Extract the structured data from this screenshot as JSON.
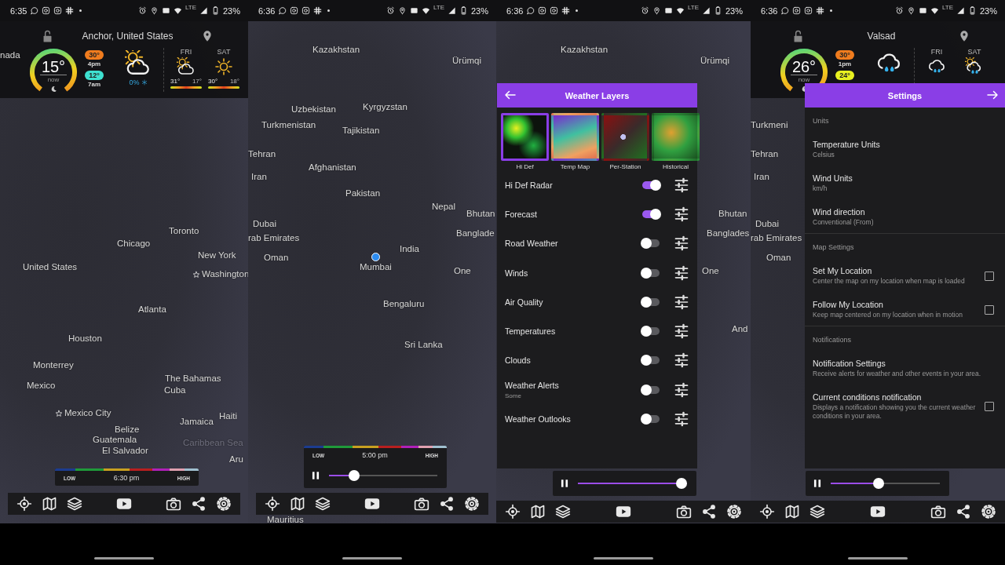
{
  "screens": [
    {
      "kind": "map",
      "status_bar": {
        "time": "6:35",
        "network": "LTE",
        "battery": "23%"
      },
      "weather": {
        "location": "Anchor, United States",
        "current": {
          "temp": "15°",
          "label": "now"
        },
        "high": {
          "temp": "30°",
          "time": "4pm",
          "color": "#f07c1e"
        },
        "low": {
          "temp": "12°",
          "time": "7am",
          "color": "#3ee0d0"
        },
        "condition": {
          "kind": "partly-cloudy",
          "precip": "0%"
        },
        "days": [
          {
            "day": "FRI",
            "kind": "partly-cloudy",
            "high": "31°",
            "low": "17°"
          },
          {
            "day": "SAT",
            "kind": "sunny",
            "high": "30°",
            "low": "18°"
          }
        ]
      },
      "map_labels": [
        {
          "text": "nada",
          "kind": "place"
        },
        {
          "text": "United States",
          "kind": "place"
        },
        {
          "text": "Chicago",
          "kind": "place"
        },
        {
          "text": "Toronto",
          "kind": "place"
        },
        {
          "text": "New York",
          "kind": "place"
        },
        {
          "text": "Washington",
          "kind": "capital"
        },
        {
          "text": "Atlanta",
          "kind": "place"
        },
        {
          "text": "Houston",
          "kind": "place"
        },
        {
          "text": "Monterrey",
          "kind": "place"
        },
        {
          "text": "Mexico",
          "kind": "place"
        },
        {
          "text": "The Bahamas",
          "kind": "place"
        },
        {
          "text": "Cuba",
          "kind": "place"
        },
        {
          "text": "Mexico City",
          "kind": "capital"
        },
        {
          "text": "Haiti",
          "kind": "place"
        },
        {
          "text": "Belize",
          "kind": "place"
        },
        {
          "text": "Jamaica",
          "kind": "place"
        },
        {
          "text": "Guatemala",
          "kind": "place"
        },
        {
          "text": "El Salvador",
          "kind": "place"
        },
        {
          "text": "Caribbean Sea",
          "kind": "sea"
        },
        {
          "text": "Aru",
          "kind": "place"
        }
      ],
      "player": {
        "legend": {
          "low": "LOW",
          "time": "6:30 pm",
          "high": "HIGH"
        }
      }
    },
    {
      "kind": "map",
      "status_bar": {
        "time": "6:36",
        "network": "LTE",
        "battery": "23%"
      },
      "map_labels": [
        {
          "text": "Kazakhstan",
          "kind": "place"
        },
        {
          "text": "Ürümqi",
          "kind": "place"
        },
        {
          "text": "Uzbekistan",
          "kind": "place"
        },
        {
          "text": "Kyrgyzstan",
          "kind": "place"
        },
        {
          "text": "Turkmenistan",
          "kind": "place"
        },
        {
          "text": "Tajikistan",
          "kind": "place"
        },
        {
          "text": "Tehran",
          "kind": "place"
        },
        {
          "text": "Afghanistan",
          "kind": "place"
        },
        {
          "text": "Iran",
          "kind": "place"
        },
        {
          "text": "Pakistan",
          "kind": "place"
        },
        {
          "text": "Nepal",
          "kind": "place"
        },
        {
          "text": "Bhutan",
          "kind": "place"
        },
        {
          "text": "Banglade",
          "kind": "place"
        },
        {
          "text": "Dubai",
          "kind": "place"
        },
        {
          "text": "rab Emirates",
          "kind": "place"
        },
        {
          "text": "Oman",
          "kind": "place"
        },
        {
          "text": "India",
          "kind": "place"
        },
        {
          "text": "Mumbai",
          "kind": "located"
        },
        {
          "text": "One",
          "kind": "place"
        },
        {
          "text": "Bengaluru",
          "kind": "place"
        },
        {
          "text": "Sri Lanka",
          "kind": "place"
        },
        {
          "text": "Mauritius",
          "kind": "place"
        }
      ],
      "player": {
        "legend": {
          "low": "LOW",
          "time": "5:00 pm",
          "high": "HIGH"
        },
        "playing": true,
        "level": 0.2
      }
    },
    {
      "kind": "layers",
      "status_bar": {
        "time": "6:36",
        "network": "LTE",
        "battery": "23%"
      },
      "map_labels": [
        {
          "text": "Kazakhstan",
          "kind": "place"
        },
        {
          "text": "Ürümqi",
          "kind": "place"
        },
        {
          "text": "Bhutan",
          "kind": "place"
        },
        {
          "text": "Banglades",
          "kind": "place"
        },
        {
          "text": "One",
          "kind": "place"
        },
        {
          "text": "And",
          "kind": "place"
        }
      ],
      "layers_card": {
        "title": "Weather Layers",
        "thumbnails": [
          {
            "label": "Hi Def",
            "selected": true
          },
          {
            "label": "Temp Map",
            "selected": false
          },
          {
            "label": "Per-Station",
            "selected": false
          },
          {
            "label": "Historical",
            "selected": false
          }
        ],
        "layers": [
          {
            "label": "Hi Def Radar",
            "on": true
          },
          {
            "label": "Forecast",
            "on": true
          },
          {
            "label": "Road Weather",
            "on": false
          },
          {
            "label": "Winds",
            "on": false
          },
          {
            "label": "Air Quality",
            "on": false
          },
          {
            "label": "Temperatures",
            "on": false
          },
          {
            "label": "Clouds",
            "on": false
          },
          {
            "label": "Weather Alerts",
            "detail": "Some",
            "on": false
          },
          {
            "label": "Weather Outlooks",
            "on": false
          }
        ]
      },
      "player": {
        "playing": true,
        "level": 1
      }
    },
    {
      "kind": "settings",
      "status_bar": {
        "time": "6:36",
        "network": "LTE",
        "battery": "23%"
      },
      "weather": {
        "location": "Valsad",
        "current": {
          "temp": "26°",
          "label": "now"
        },
        "high": {
          "temp": "30°",
          "time": "1pm",
          "color": "#f07c1e"
        },
        "low": {
          "temp": "24°",
          "color": "#e8f020"
        },
        "condition": {
          "kind": "rain"
        },
        "days": [
          {
            "day": "FRI",
            "kind": "rain"
          },
          {
            "day": "SAT",
            "kind": "sun-rain"
          }
        ]
      },
      "map_labels": [
        {
          "text": "Turkmeni",
          "kind": "place"
        },
        {
          "text": "Tehran",
          "kind": "place"
        },
        {
          "text": "Iran",
          "kind": "place"
        },
        {
          "text": "Dubai",
          "kind": "place"
        },
        {
          "text": "rab Emirates",
          "kind": "place"
        },
        {
          "text": "Oman",
          "kind": "place"
        }
      ],
      "settings_card": {
        "title": "Settings",
        "sections": [
          {
            "heading": "Units",
            "items": [
              {
                "kind": "value",
                "title": "Temperature Units",
                "detail": "Celsius"
              },
              {
                "kind": "value",
                "title": "Wind Units",
                "detail": "km/h"
              },
              {
                "kind": "value",
                "title": "Wind direction",
                "detail": "Conventional (From)"
              }
            ]
          },
          {
            "heading": "Map Settings",
            "items": [
              {
                "kind": "checkbox",
                "title": "Set My Location",
                "detail": "Center the map on my location when map is loaded",
                "checked": false
              },
              {
                "kind": "checkbox",
                "title": "Follow My Location",
                "detail": "Keep map centered on my location when in motion",
                "checked": false
              }
            ]
          },
          {
            "heading": "Notifications",
            "items": [
              {
                "kind": "value",
                "title": "Notification Settings",
                "detail": "Receive alerts for weather and other events in your area."
              },
              {
                "kind": "checkbox",
                "title": "Current conditions notification",
                "detail": "Displays a notification showing you the current weather conditions in your area.",
                "checked": false
              }
            ]
          }
        ]
      },
      "player": {
        "playing": true,
        "level": 0.43
      }
    }
  ]
}
